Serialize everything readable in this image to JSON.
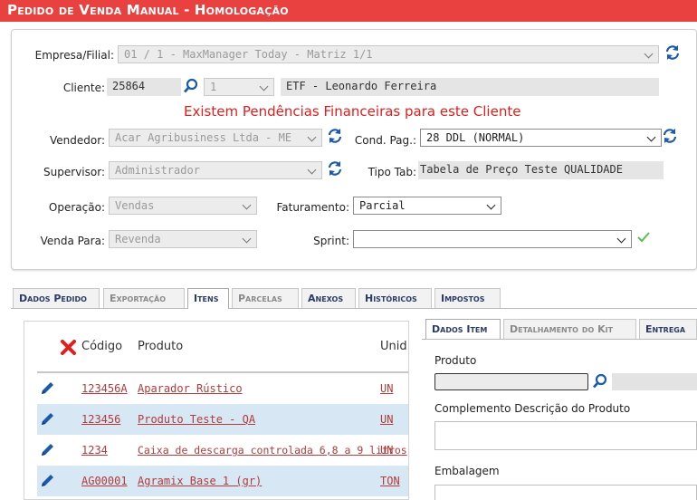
{
  "title": "Pedido de Venda Manual  - Homologação",
  "form": {
    "empresa": {
      "label": "Empresa/Filial:",
      "value": "01 / 1 - MaxManager Today - Matriz 1/1"
    },
    "cliente": {
      "label": "Cliente:",
      "code": "25864",
      "branch": "1",
      "name": "ETF - Leonardo Ferreira"
    },
    "warning": "Existem Pendências Financeiras para este Cliente",
    "vendedor": {
      "label": "Vendedor:",
      "value": "Acar Agribusiness Ltda - ME"
    },
    "cond_pag": {
      "label": "Cond. Pag.:",
      "value": "28 DDL (NORMAL)"
    },
    "supervisor": {
      "label": "Supervisor:",
      "value": "Administrador"
    },
    "tipo_tab": {
      "label": "Tipo Tab:",
      "value": "Tabela de Preço Teste QUALIDADE"
    },
    "operacao": {
      "label": "Operação:",
      "value": "Vendas"
    },
    "faturamento": {
      "label": "Faturamento:",
      "value": "Parcial"
    },
    "venda_para": {
      "label": "Venda Para:",
      "value": "Revenda"
    },
    "sprint": {
      "label": "Sprint:",
      "value": ""
    }
  },
  "tabs": [
    "Dados Pedido",
    "Exportação",
    "Itens",
    "Parcelas",
    "Anexos",
    "Históricos",
    "Impostos"
  ],
  "items": {
    "headers": {
      "codigo": "Código",
      "produto": "Produto",
      "unid": "Unid"
    },
    "rows": [
      {
        "codigo": "123456A",
        "produto": "Aparador Rústico",
        "unid": "UN"
      },
      {
        "codigo": "123456",
        "produto": "Produto Teste - QA",
        "unid": "UN"
      },
      {
        "codigo": "1234",
        "produto": "Caixa de descarga controlada 6,8 a 9 litros",
        "unid": "UN"
      },
      {
        "codigo": "AG00001",
        "produto": "Agramix Base 1 (gr)",
        "unid": "TON"
      }
    ]
  },
  "item_tabs": [
    "Dados Item",
    "Detalhamento do Kit",
    "Entrega"
  ],
  "item_detail": {
    "produto_label": "Produto",
    "complemento_label": "Complemento Descrição do Produto",
    "embalagem_label": "Embalagem"
  },
  "colors": {
    "title_bar": "#e8413f",
    "accent_blue": "#1a5aa8",
    "warning_red": "#e01e1e",
    "link_red": "#b23b3b",
    "row_alt": "#d7e7f3",
    "check_green": "#5bbf4f"
  },
  "icons": [
    "refresh-icon",
    "search-icon",
    "edit-icon",
    "delete-icon",
    "check-icon"
  ]
}
